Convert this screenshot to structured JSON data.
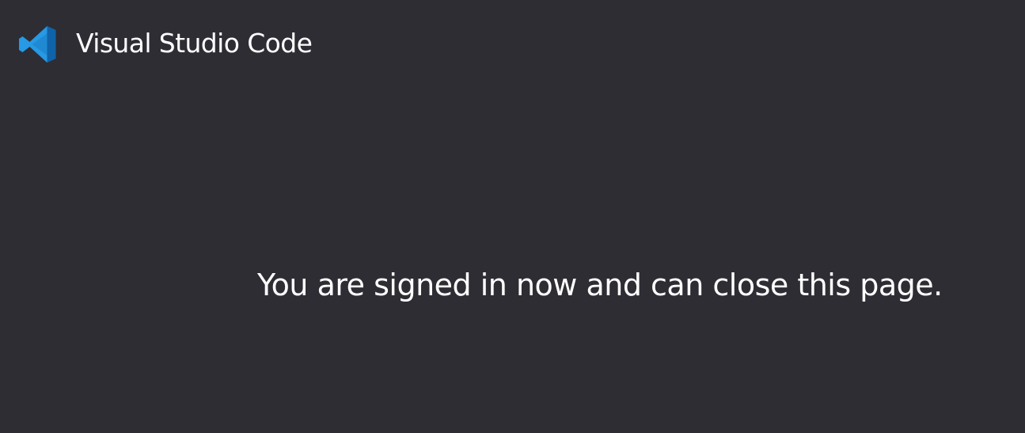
{
  "header": {
    "logo_icon": "vscode-logo-icon",
    "brand_name": "Visual Studio Code"
  },
  "main": {
    "message": "You are signed in now and can close this page."
  },
  "colors": {
    "background": "#2e2d34",
    "text": "#ffffff",
    "logo_blue": "#1f8ad2",
    "logo_dark": "#0f63a8"
  }
}
